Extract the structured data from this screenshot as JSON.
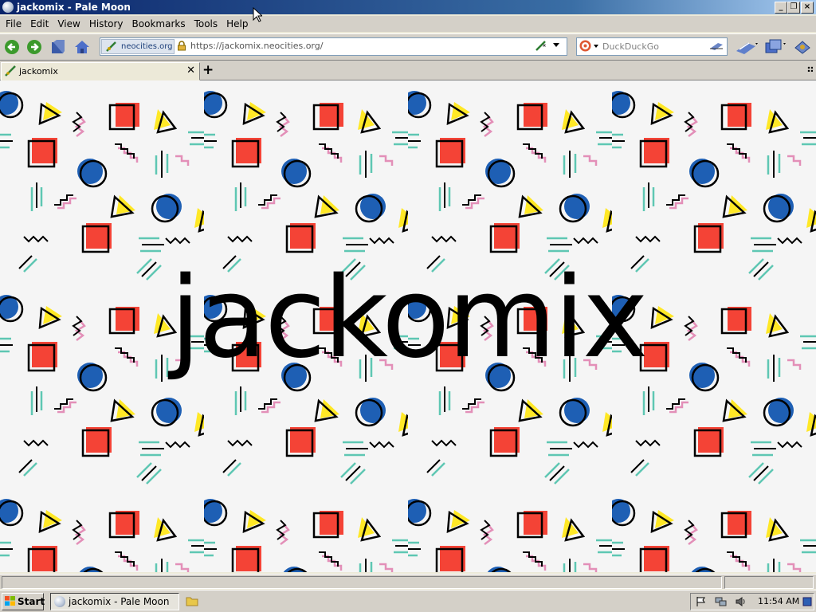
{
  "window": {
    "title": "jackomix - Pale Moon"
  },
  "menu": [
    "File",
    "Edit",
    "View",
    "History",
    "Bookmarks",
    "Tools",
    "Help"
  ],
  "toolbar": {
    "identity_label": "neocities.org",
    "url": "https://jackomix.neocities.org/",
    "search_placeholder": "DuckDuckGo"
  },
  "tabs": [
    {
      "label": "jackomix"
    }
  ],
  "page": {
    "heading": "jackomix"
  },
  "taskbar": {
    "start_label": "Start",
    "task_label": "jackomix - Pale Moon",
    "clock": "11:54 AM"
  },
  "colors": {
    "red": "#f44336",
    "blue": "#1e5fb4",
    "yellow": "#ffe826",
    "teal": "#5ec7b3",
    "pink": "#e38fb8"
  }
}
